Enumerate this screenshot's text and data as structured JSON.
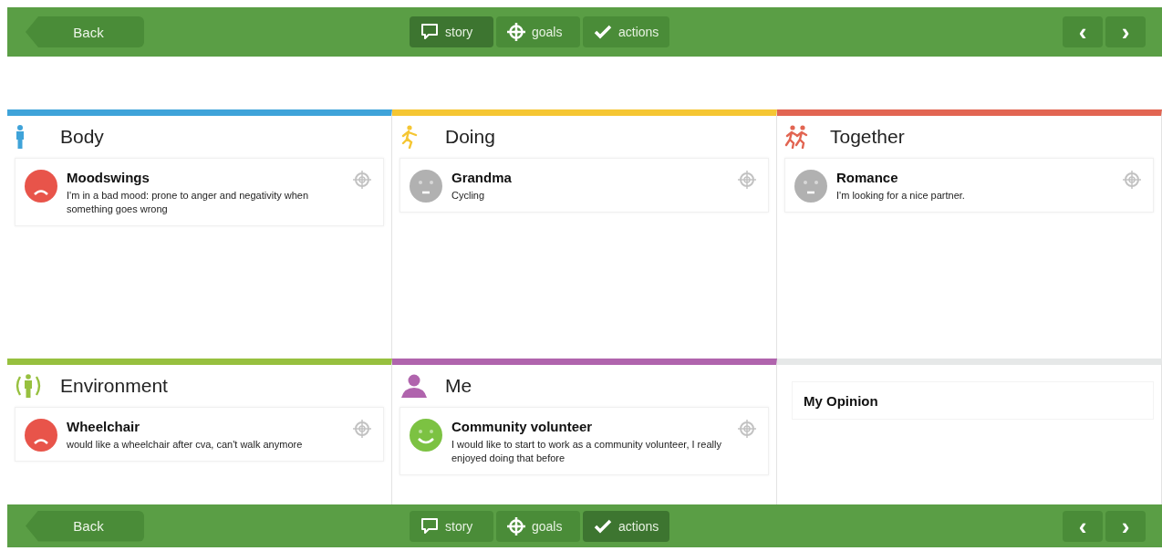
{
  "top_bar": {
    "back": "Back",
    "tabs": [
      {
        "kind": "story",
        "label": "story",
        "selected": true
      },
      {
        "kind": "goals",
        "label": "goals",
        "selected": false
      },
      {
        "kind": "actions",
        "label": "actions",
        "selected": false
      }
    ],
    "prev": "‹",
    "next": "›"
  },
  "panels": [
    {
      "kind": "body",
      "title": "Body",
      "color": "#3fa3d9",
      "items": [
        {
          "kind": "sad",
          "title": "Moodswings",
          "text": "I'm in a bad mood: prone to anger and negativity when something goes wrong"
        }
      ]
    },
    {
      "kind": "doing",
      "title": "Doing",
      "color": "#f5c633",
      "items": [
        {
          "kind": "neutral",
          "title": "Grandma",
          "text": "Cycling"
        }
      ]
    },
    {
      "kind": "together",
      "title": "Together",
      "color": "#e26552",
      "items": [
        {
          "kind": "neutral",
          "title": "Romance",
          "text": "I'm looking for a nice partner."
        }
      ]
    },
    {
      "kind": "environment",
      "title": "Environment",
      "color": "#97c03f",
      "items": [
        {
          "kind": "sad",
          "title": "Wheelchair",
          "text": "would like a wheelchair after cva, can't walk anymore"
        }
      ]
    },
    {
      "kind": "me",
      "title": "Me",
      "color": "#b064ad",
      "items": [
        {
          "kind": "happy",
          "title": "Community volunteer",
          "text": " I would like to start to work as a community volunteer, I really enjoyed doing that before"
        }
      ]
    },
    {
      "kind": "opinion",
      "title": "My Opinion",
      "color": "#e6e8e8"
    }
  ],
  "bottom_bar": {
    "back": "Back",
    "tabs": [
      {
        "kind": "story",
        "label": "story",
        "selected": false
      },
      {
        "kind": "goals",
        "label": "goals",
        "selected": false
      },
      {
        "kind": "actions",
        "label": "actions",
        "selected": true
      }
    ],
    "prev": "‹",
    "next": "›"
  }
}
